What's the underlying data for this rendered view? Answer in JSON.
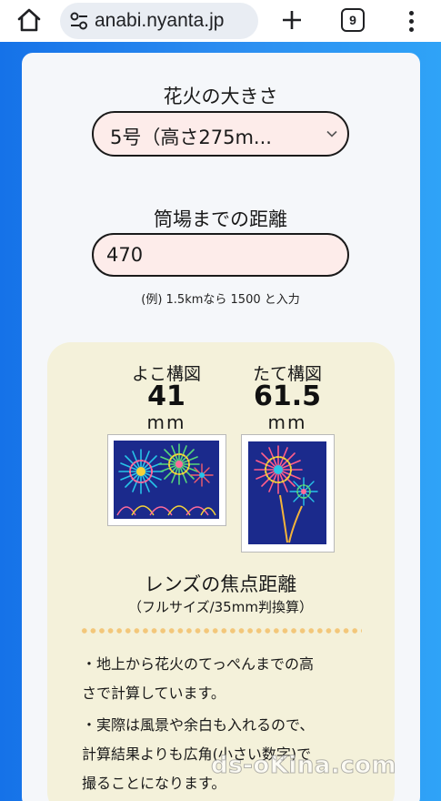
{
  "browser": {
    "url": "anabi.nyanta.jp",
    "tab_count": "9"
  },
  "form": {
    "size_label": "花火の大きさ",
    "size_selected": "5号（高さ275m...",
    "distance_label": "筒場までの距離",
    "distance_value": "470",
    "distance_hint": "(例) 1.5kmなら 1500 と入力"
  },
  "result": {
    "horizontal": {
      "label": "よこ構図",
      "value": "41",
      "unit": "mm"
    },
    "vertical": {
      "label": "たて構図",
      "value": "61.5",
      "unit": "mm"
    },
    "focal_title": "レンズの焦点距離",
    "focal_subtitle": "（フルサイズ/35mm判換算）",
    "notes": [
      "・地上から花火のてっぺんまでの高",
      "さで計算しています。",
      "・実際は風景や余白も入れるので、",
      "計算結果よりも広角(小さい数字)で",
      "撮ることになります。"
    ]
  },
  "watermark": "ds-oKina.com",
  "colors": {
    "page_gradient_start": "#1572e8",
    "page_gradient_end": "#2fa3f7",
    "field_background": "#fdecea",
    "result_panel": "#f4f1da",
    "night_sky": "#1b2a8c"
  },
  "icons": [
    "home-icon",
    "site-info-icon",
    "plus-icon",
    "tabs-icon",
    "more-vert-icon",
    "chevron-down-icon"
  ]
}
